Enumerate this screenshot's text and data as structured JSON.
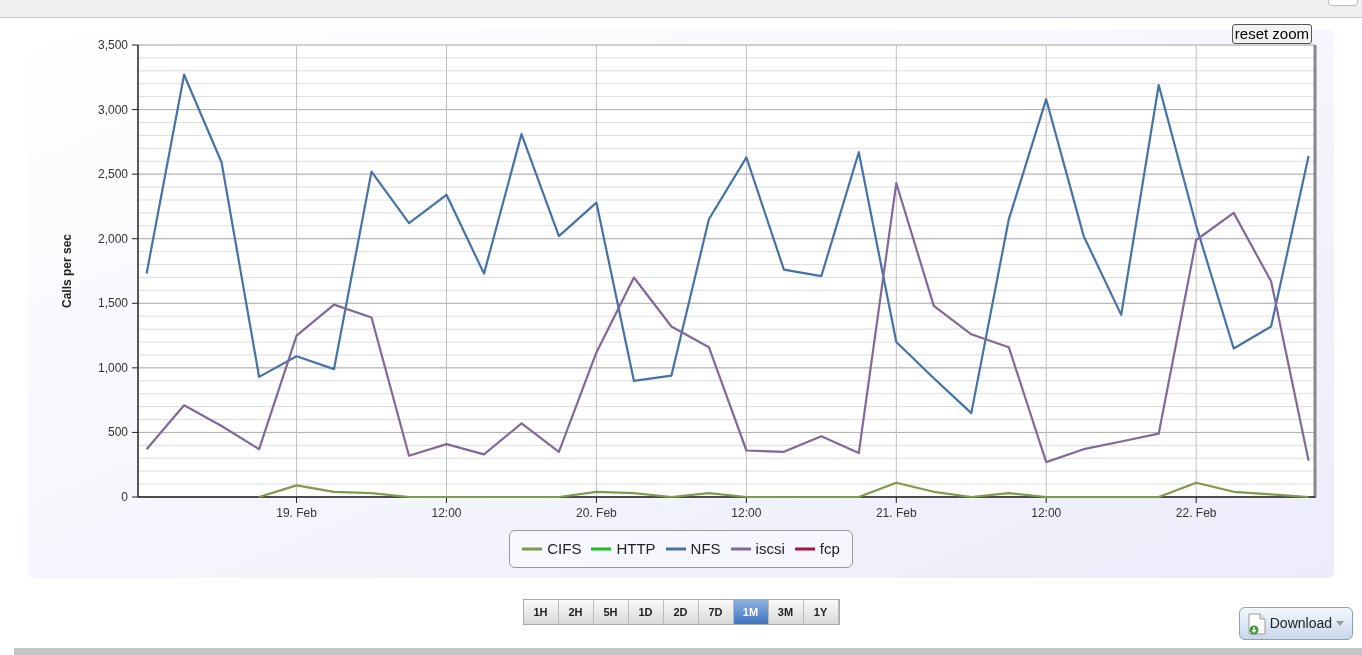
{
  "chart": {
    "reset_zoom": "reset zoom",
    "chart_data": {
      "type": "line",
      "ylabel": "Calls per sec",
      "categories": [
        null,
        null,
        null,
        null,
        "19. Feb",
        null,
        null,
        null,
        "12:00",
        null,
        null,
        null,
        "20. Feb",
        null,
        null,
        null,
        "12:00",
        null,
        null,
        null,
        "21. Feb",
        null,
        null,
        null,
        "12:00",
        null,
        null,
        null,
        "22. Feb",
        null,
        null,
        null
      ],
      "series": [
        {
          "name": "CIFS",
          "color": "#7f9a48",
          "values": [
            null,
            null,
            null,
            0,
            90,
            40,
            30,
            0,
            0,
            0,
            0,
            0,
            40,
            30,
            0,
            30,
            0,
            0,
            0,
            0,
            110,
            40,
            0,
            30,
            0,
            0,
            0,
            0,
            110,
            40,
            20,
            0
          ]
        },
        {
          "name": "HTTP",
          "color": "#22bb22",
          "values": [
            null,
            null,
            null,
            null,
            null,
            null,
            null,
            null,
            null,
            null,
            null,
            null,
            null,
            null,
            null,
            null,
            null,
            null,
            null,
            null,
            null,
            null,
            null,
            null,
            null,
            null,
            null,
            null,
            null,
            null,
            null,
            null
          ]
        },
        {
          "name": "NFS",
          "color": "#4572a7",
          "values": [
            1730,
            3270,
            2590,
            930,
            1090,
            990,
            2520,
            2120,
            2340,
            1730,
            2810,
            2020,
            2280,
            900,
            940,
            2150,
            2630,
            1760,
            1710,
            2670,
            1200,
            920,
            650,
            2150,
            3080,
            2020,
            1410,
            3190,
            2100,
            1150,
            1320,
            2640
          ]
        },
        {
          "name": "iscsi",
          "color": "#80699b",
          "values": [
            370,
            710,
            550,
            370,
            1250,
            1490,
            1390,
            320,
            410,
            330,
            570,
            350,
            1120,
            1700,
            1320,
            1160,
            360,
            350,
            470,
            340,
            2430,
            1480,
            1260,
            1160,
            270,
            370,
            430,
            490,
            1990,
            2200,
            1670,
            280
          ]
        },
        {
          "name": "fcp",
          "color": "#aa1144",
          "values": [
            null,
            null,
            null,
            null,
            null,
            null,
            null,
            null,
            null,
            null,
            null,
            null,
            null,
            null,
            null,
            null,
            null,
            null,
            null,
            null,
            null,
            null,
            null,
            null,
            null,
            null,
            null,
            null,
            null,
            null,
            null,
            null
          ]
        }
      ],
      "grid": true,
      "ylim": [
        0,
        3500
      ],
      "yticks": [
        {
          "value": 0,
          "label": "0"
        },
        {
          "value": 500,
          "label": "500"
        },
        {
          "value": 1000,
          "label": "1,000"
        },
        {
          "value": 1500,
          "label": "1,500"
        },
        {
          "value": 2000,
          "label": "2,000"
        },
        {
          "value": 2500,
          "label": "2,500"
        },
        {
          "value": 3000,
          "label": "3,000"
        },
        {
          "value": 3500,
          "label": "3,500"
        }
      ]
    }
  },
  "ranges": [
    {
      "label": "1H",
      "selected": false
    },
    {
      "label": "2H",
      "selected": false
    },
    {
      "label": "5H",
      "selected": false
    },
    {
      "label": "1D",
      "selected": false
    },
    {
      "label": "2D",
      "selected": false
    },
    {
      "label": "7D",
      "selected": false
    },
    {
      "label": "1M",
      "selected": true
    },
    {
      "label": "3M",
      "selected": false
    },
    {
      "label": "1Y",
      "selected": false
    }
  ],
  "download": "Download"
}
